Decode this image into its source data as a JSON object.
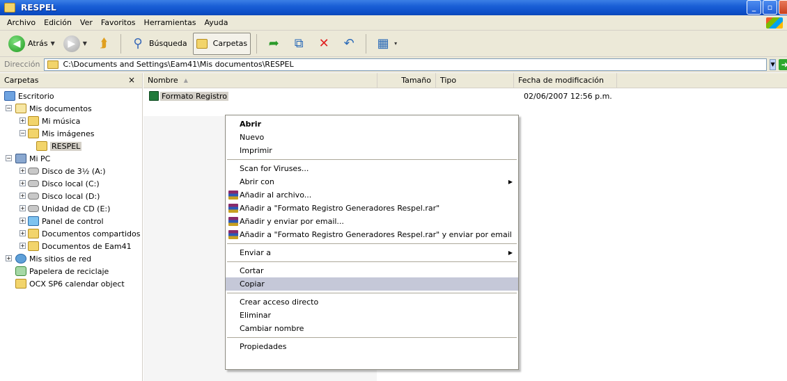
{
  "window": {
    "title": "RESPEL"
  },
  "menubar": [
    "Archivo",
    "Edición",
    "Ver",
    "Favoritos",
    "Herramientas",
    "Ayuda"
  ],
  "toolbar": {
    "back": "Atrás",
    "search": "Búsqueda",
    "folders": "Carpetas"
  },
  "address": {
    "label": "Dirección",
    "path": "C:\\Documents and Settings\\Eam41\\Mis documentos\\RESPEL",
    "go": "Ir"
  },
  "folders_pane": {
    "title": "Carpetas",
    "close": "×",
    "tree": [
      {
        "label": "Escritorio"
      },
      {
        "label": "Mis documentos"
      },
      {
        "label": "Mi música"
      },
      {
        "label": "Mis imágenes"
      },
      {
        "label": "RESPEL"
      },
      {
        "label": "Mi PC"
      },
      {
        "label": "Disco de 3½ (A:)"
      },
      {
        "label": "Disco local (C:)"
      },
      {
        "label": "Disco local (D:)"
      },
      {
        "label": "Unidad de CD (E:)"
      },
      {
        "label": "Panel de control"
      },
      {
        "label": "Documentos compartidos"
      },
      {
        "label": "Documentos de Eam41"
      },
      {
        "label": "Mis sitios de red"
      },
      {
        "label": "Papelera de reciclaje"
      },
      {
        "label": "OCX SP6 calendar object"
      }
    ]
  },
  "columns": {
    "name": "Nombre",
    "size": "Tamaño",
    "type": "Tipo",
    "modified": "Fecha de modificación"
  },
  "file": {
    "name": "Formato Registro",
    "modified": "02/06/2007 12:56 p.m."
  },
  "context_menu": {
    "open": "Abrir",
    "new": "Nuevo",
    "print": "Imprimir",
    "scan": "Scan for Viruses...",
    "open_with": "Abrir con",
    "add_archive": "Añadir al archivo...",
    "add_rar": "Añadir a \"Formato Registro Generadores Respel.rar\"",
    "add_email": "Añadir y enviar por email...",
    "add_rar_email": "Añadir a \"Formato Registro Generadores Respel.rar\" y enviar por email",
    "send_to": "Enviar a",
    "cut": "Cortar",
    "copy": "Copiar",
    "shortcut": "Crear acceso directo",
    "delete": "Eliminar",
    "rename": "Cambiar nombre",
    "properties": "Propiedades"
  }
}
